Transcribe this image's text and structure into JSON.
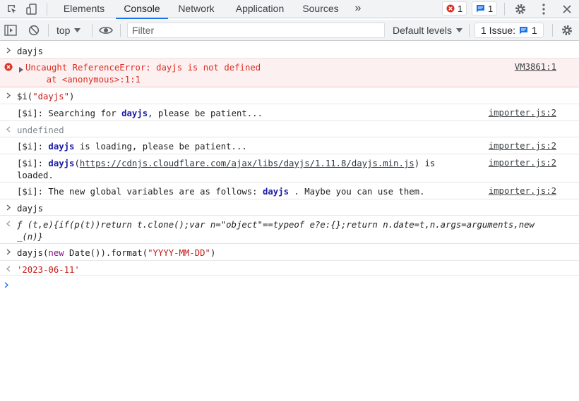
{
  "tabs": {
    "elements": "Elements",
    "console": "Console",
    "network": "Network",
    "application": "Application",
    "sources": "Sources",
    "more": "»"
  },
  "badges": {
    "errors": "1",
    "messages": "1"
  },
  "toolbar": {
    "context": "top",
    "filter_placeholder": "Filter",
    "levels": "Default levels",
    "issues_label": "1 Issue:",
    "issues_count": "1"
  },
  "console": {
    "r1": "dayjs",
    "r2_line1": "Uncaught ReferenceError: dayjs is not defined",
    "r2_line2": "    at <anonymous>:1:1",
    "r2_src": "VM3861:1",
    "r3_pre": "$i(",
    "r3_str": "\"dayjs\"",
    "r3_post": ")",
    "r4_prefix": "[$i]: Searching for ",
    "r4_kw": "dayjs",
    "r4_suffix": ", please be patient...",
    "r4_src": "importer.js:2",
    "r5": "undefined",
    "r6_prefix": "[$i]: ",
    "r6_kw": "dayjs",
    "r6_suffix": " is loading, please be patient...",
    "r6_src": "importer.js:2",
    "r7_prefix": "[$i]: ",
    "r7_kw": "dayjs",
    "r7_open": "(",
    "r7_url": "https://cdnjs.cloudflare.com/ajax/libs/dayjs/1.11.8/dayjs.min.js",
    "r7_close": ") is",
    "r7_line2": "loaded.",
    "r7_src": "importer.js:2",
    "r8_prefix": "[$i]: The new global variables are as follows: ",
    "r8_kw": "dayjs",
    "r8_suffix": " . Maybe you can use them.",
    "r8_src": "importer.js:2",
    "r9": "dayjs",
    "r10_line1": "ƒ (t,e){if(p(t))return t.clone();var n=\"object\"==typeof e?e:{};return n.date=t,n.args=arguments,new",
    "r10_line2": "_(n)}",
    "r11_pre": "dayjs(",
    "r11_new": "new",
    "r11_mid": " Date()).format(",
    "r11_str": "\"YYYY-MM-DD\"",
    "r11_post": ")",
    "r12": "'2023-06-11'"
  },
  "colors": {
    "accent": "#1a73e8",
    "error": "#d93025",
    "error_bg": "#fdf0f0",
    "keyword": "#1a1aa6",
    "string": "#c41a16"
  }
}
